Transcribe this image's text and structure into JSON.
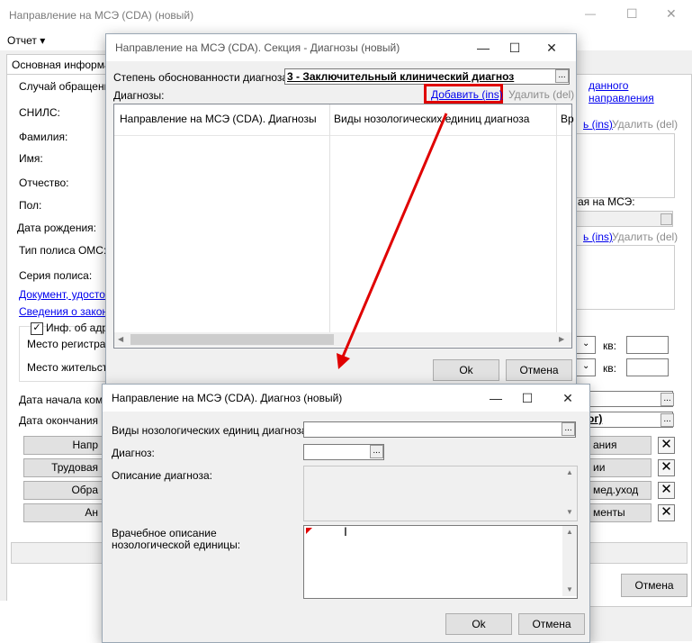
{
  "main_window": {
    "title": "Направление на МСЭ (CDA) (новый)",
    "menu_report": "Отчет ▾",
    "tab": "Основная информац",
    "group_case": "Случай обращени",
    "labels": {
      "snils": "СНИЛС:",
      "lastname": "Фамилия:",
      "firstname": "Имя:",
      "patronymic": "Отчество:",
      "sex": "Пол:",
      "birthdate": "Дата рождения:",
      "oms_type": "Тип полиса ОМС:",
      "policy_series": "Серия полиса:"
    },
    "link_document": "Документ, удостов",
    "link_legal": "Сведения о законн",
    "checkbox_address": "Инф. об адре",
    "reg_place": "Место регистрац",
    "live_place": "Место жительств",
    "kv1": "кв:",
    "kv2": "кв:",
    "date_start": "Дата начала ком",
    "date_end": "Дата окончания к",
    "left_buttons": [
      "Напр",
      "Трудовая",
      "Обра",
      "Ан"
    ],
    "right_buttons": [
      "ания",
      "ии",
      "мед.уход",
      "менты"
    ],
    "right_link_sent": "данного направления",
    "right_add1": "ь (ins)",
    "right_del1": "Удалить (del)",
    "right_label_mse": "ая на МСЭ:",
    "right_add2": "ь (ins)",
    "right_del2": "Удалить (del)",
    "right_field_og": "ог)",
    "cancel_button": "Отмена"
  },
  "section_dialog": {
    "title": "Направление на МСЭ (CDA). Секция - Диагнозы (новый)",
    "degree_label": "Степень обоснованности диагноза:",
    "degree_value": "3 - Заключительный клинический диагноз",
    "diagnoses_label": "Диагнозы:",
    "add_link": "Добавить (ins)",
    "delete_link": "Удалить (del)",
    "columns": [
      "Направление на МСЭ (CDA). Диагнозы",
      "Виды нозологических единиц диагноза",
      "Вр"
    ],
    "ok": "Ok",
    "cancel": "Отмена"
  },
  "diagnosis_dialog": {
    "title": "Направление на МСЭ (CDA). Диагноз (новый)",
    "nosology_label": "Виды нозологических единиц диагноза:",
    "nosology_value": "",
    "diagnosis_label": "Диагноз:",
    "diagnosis_value": "",
    "description_label": "Описание диагноза:",
    "doctor_label_1": "Врачебное описание",
    "doctor_label_2": "нозологической единицы:",
    "ok": "Ok",
    "cancel": "Отмена"
  },
  "colors": {
    "annotation_red": "#e00000",
    "link_blue": "#0000ee"
  },
  "icons": {
    "dots": "...",
    "close": "✕",
    "maximize": "☐",
    "minimize": "—"
  }
}
